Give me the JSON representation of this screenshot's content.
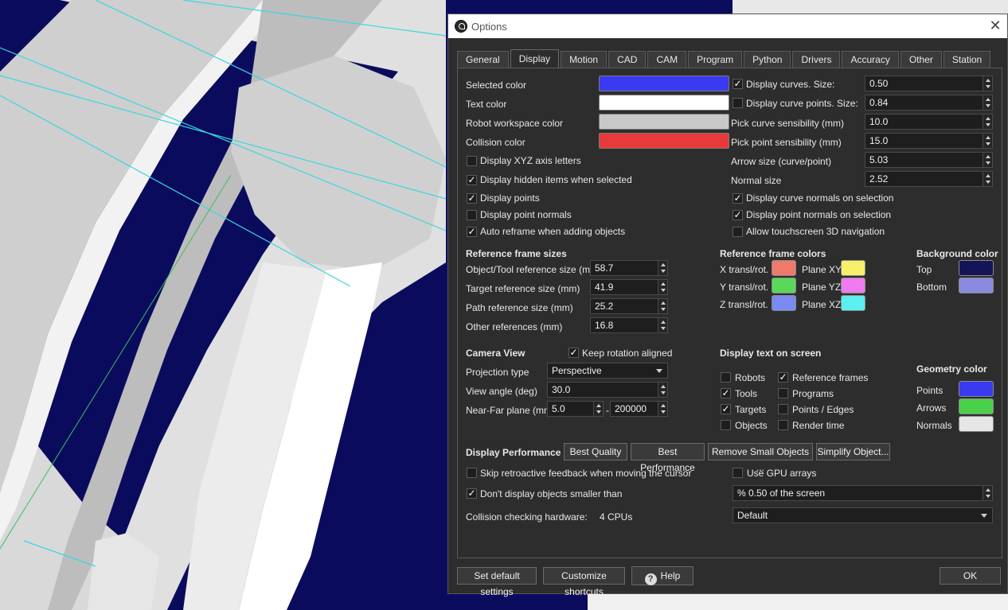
{
  "window": {
    "title": "Options",
    "close_glyph": "✕"
  },
  "tabs": [
    {
      "label": "General"
    },
    {
      "label": "Display",
      "active": true
    },
    {
      "label": "Motion"
    },
    {
      "label": "CAD"
    },
    {
      "label": "CAM"
    },
    {
      "label": "Program"
    },
    {
      "label": "Python"
    },
    {
      "label": "Drivers"
    },
    {
      "label": "Accuracy"
    },
    {
      "label": "Other"
    },
    {
      "label": "Station"
    }
  ],
  "colors_section": {
    "selected_color": {
      "label": "Selected color",
      "value": "#3a3af0"
    },
    "text_color": {
      "label": "Text color",
      "value": "#ffffff"
    },
    "robot_workspace_color": {
      "label": "Robot workspace color",
      "value": "#c8c8c8"
    },
    "collision_color": {
      "label": "Collision color",
      "value": "#e83a3a"
    }
  },
  "left_checks": {
    "xyz_axis": {
      "label": "Display XYZ axis letters",
      "checked": false
    },
    "hidden_items": {
      "label": "Display hidden items when selected",
      "checked": true
    },
    "points": {
      "label": "Display points",
      "checked": true
    },
    "point_normals": {
      "label": "Display point normals",
      "checked": false
    },
    "auto_reframe": {
      "label": "Auto reframe when adding objects",
      "checked": true
    }
  },
  "curves": {
    "display_curves": {
      "label": "Display curves. Size:",
      "checked": true,
      "value": "0.50"
    },
    "display_curve_points": {
      "label": "Display curve points. Size:",
      "checked": false,
      "value": "0.84"
    },
    "pick_curve": {
      "label": "Pick curve sensibility (mm)",
      "value": "10.0"
    },
    "pick_point": {
      "label": "Pick point sensibility (mm)",
      "value": "15.0"
    },
    "arrow_size": {
      "label": "Arrow size (curve/point)",
      "value": "5.03"
    },
    "normal_size": {
      "label": "Normal size",
      "value": "2.52"
    },
    "curve_normals": {
      "label": "Display curve normals on selection",
      "checked": true
    },
    "point_normals_sel": {
      "label": "Display point normals on selection",
      "checked": true
    },
    "touchscreen": {
      "label": "Allow touchscreen 3D navigation",
      "checked": false
    }
  },
  "ref_sizes": {
    "heading": "Reference frame sizes",
    "object_tool": {
      "label": "Object/Tool reference size (mm)",
      "value": "58.7"
    },
    "target": {
      "label": "Target reference size (mm)",
      "value": "41.9"
    },
    "path": {
      "label": "Path reference size (mm)",
      "value": "25.2"
    },
    "other": {
      "label": "Other references (mm)",
      "value": "16.8"
    }
  },
  "ref_colors": {
    "heading": "Reference frame colors",
    "x_label": "X transl/rot.",
    "x_color": "#f07a6a",
    "y_label": "Y transl/rot.",
    "y_color": "#5ad85a",
    "z_label": "Z transl/rot.",
    "z_color": "#7a8af0",
    "xy_label": "Plane XY",
    "xy_color": "#f8f06a",
    "yz_label": "Plane YZ",
    "yz_color": "#f07af0",
    "xz_label": "Plane XZ",
    "xz_color": "#5af0f0"
  },
  "background": {
    "heading": "Background color",
    "top_label": "Top",
    "top_color": "#14145a",
    "bottom_label": "Bottom",
    "bottom_color": "#8a8ae0"
  },
  "camera": {
    "heading": "Camera View",
    "keep_rotation": {
      "label": "Keep rotation aligned",
      "checked": true
    },
    "projection_label": "Projection type",
    "projection_value": "Perspective",
    "view_angle_label": "View angle (deg)",
    "view_angle_value": "30.0",
    "near_far_label": "Near-Far plane (mm)",
    "near_value": "5.0",
    "separator": "-",
    "far_value": "200000"
  },
  "display_text": {
    "heading": "Display text on screen",
    "robots": {
      "label": "Robots",
      "checked": false
    },
    "tools": {
      "label": "Tools",
      "checked": true
    },
    "targets": {
      "label": "Targets",
      "checked": true
    },
    "objects": {
      "label": "Objects",
      "checked": false
    },
    "reference_frames": {
      "label": "Reference frames",
      "checked": true
    },
    "programs": {
      "label": "Programs",
      "checked": false
    },
    "points_edges": {
      "label": "Points / Edges",
      "checked": false
    },
    "render_time": {
      "label": "Render time",
      "checked": false
    }
  },
  "geometry": {
    "heading": "Geometry color",
    "points_label": "Points",
    "points_color": "#3a3af0",
    "arrows_label": "Arrows",
    "arrows_color": "#4ad04a",
    "normals_label": "Normals",
    "normals_color": "#e6e6e6"
  },
  "performance": {
    "heading": "Display Performance",
    "best_quality": "Best Quality",
    "best_performance": "Best Performance",
    "remove_small": "Remove Small Objects ...",
    "simplify": "Simplify Object...",
    "skip_feedback": {
      "label": "Skip retroactive feedback when moving the cursor",
      "checked": false
    },
    "gpu_arrays": {
      "label": "Use GPU arrays",
      "checked": false
    },
    "dont_display_small": {
      "label": "Don't display objects smaller than",
      "checked": true
    },
    "small_value": "% 0.50 of the screen",
    "collision_label": "Collision checking hardware:",
    "cpus": "4 CPUs",
    "collision_value": "Default"
  },
  "footer": {
    "set_default": "Set default settings",
    "shortcuts": "Customize shortcuts",
    "help": "Help",
    "help_glyph": "?",
    "ok": "OK"
  },
  "check_glyph": "✓"
}
